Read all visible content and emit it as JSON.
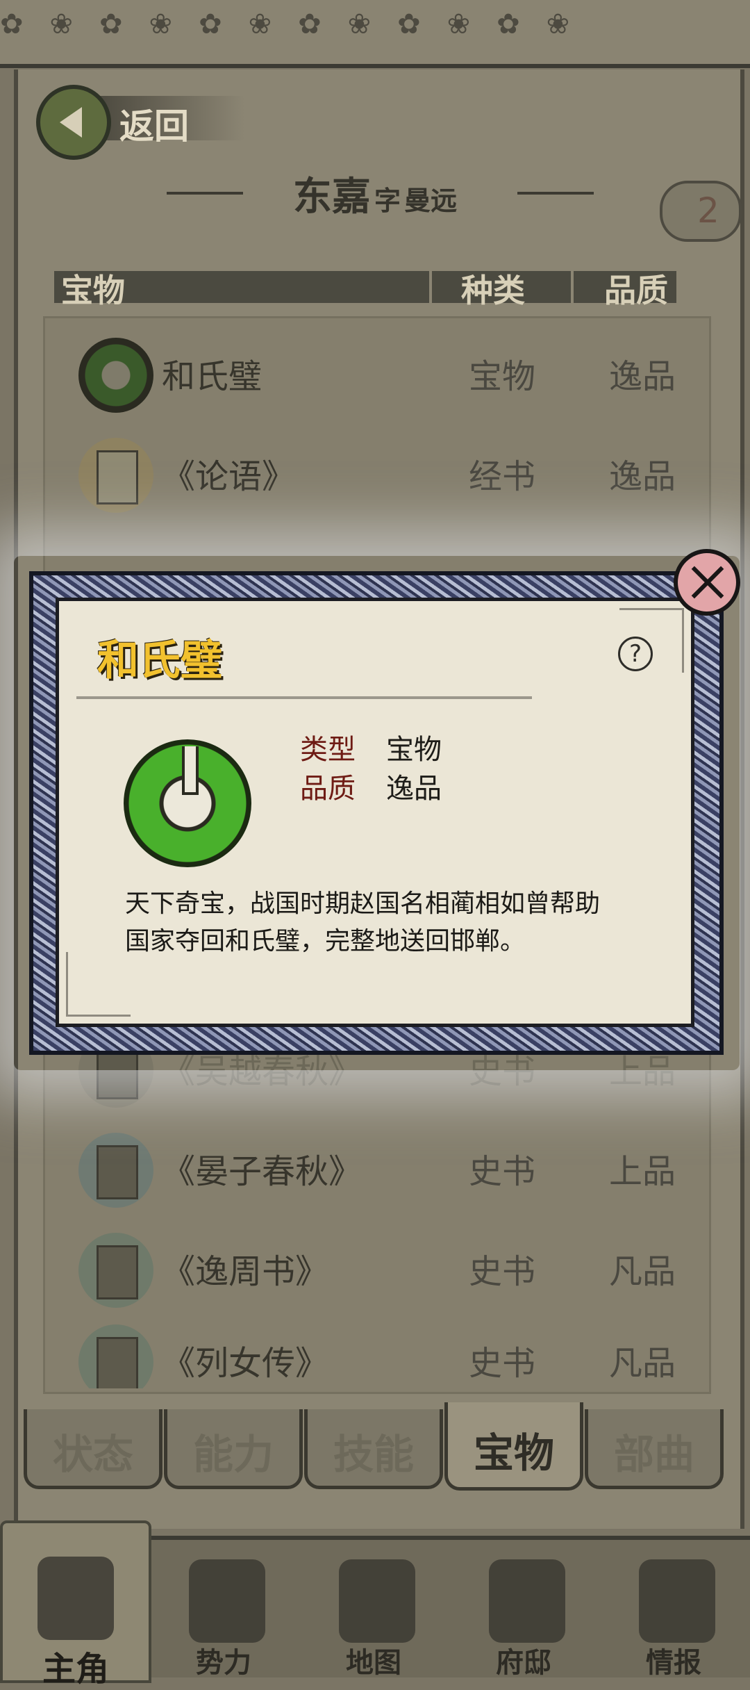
{
  "header": {
    "back_label": "返回",
    "char_name": "东嘉",
    "courtesy_prefix": "字",
    "courtesy_name": "曼远",
    "badge_count": "2"
  },
  "columns": {
    "item": "宝物",
    "type": "种类",
    "quality": "品质"
  },
  "items": [
    {
      "name": "和氏璧",
      "type": "宝物",
      "quality": "逸品",
      "icon": "jade-disc-icon"
    },
    {
      "name": "《论语》",
      "type": "经书",
      "quality": "逸品",
      "icon": "book-icon"
    },
    {
      "name": "《吴越春秋》",
      "type": "史书",
      "quality": "上品",
      "icon": "book-icon"
    },
    {
      "name": "《晏子春秋》",
      "type": "史书",
      "quality": "上品",
      "icon": "book-icon"
    },
    {
      "name": "《逸周书》",
      "type": "史书",
      "quality": "凡品",
      "icon": "book-icon"
    },
    {
      "name": "《列女传》",
      "type": "史书",
      "quality": "凡品",
      "icon": "book-icon"
    }
  ],
  "tabs": [
    "状态",
    "能力",
    "技能",
    "宝物",
    "部曲"
  ],
  "active_tab": "宝物",
  "nav": [
    "主角",
    "势力",
    "地图",
    "府邸",
    "情报"
  ],
  "active_nav": "主角",
  "modal": {
    "title": "和氏璧",
    "type_label": "类型",
    "type_value": "宝物",
    "quality_label": "品质",
    "quality_value": "逸品",
    "description_line1": "天下奇宝，战国时期赵国名相蔺相如曾帮助",
    "description_line2": "国家夺回和氏璧，完整地送回邯郸。",
    "help_symbol": "?"
  },
  "colors": {
    "title_gold": "#f2c12e",
    "jade_green": "#49b02c",
    "close_pink": "#e2a5a8",
    "label_red": "#6e1b14"
  }
}
